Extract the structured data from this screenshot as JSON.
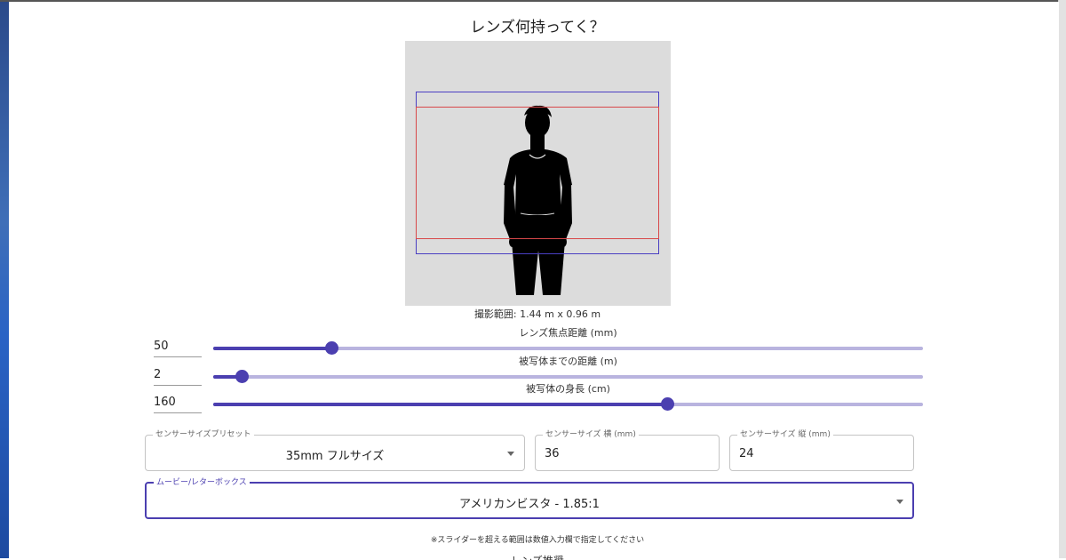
{
  "app": {
    "title": "レンズ何持ってく？"
  },
  "preview": {
    "range_text": "撮影範囲: 1.44 m x 0.96 m"
  },
  "sliders": [
    {
      "label": "レンズ焦点距離 (mm)",
      "value": "50",
      "fraction": 0.167
    },
    {
      "label": "被写体までの距離 (m)",
      "value": "2",
      "fraction": 0.04
    },
    {
      "label": "被写体の身長 (cm)",
      "value": "160",
      "fraction": 0.64
    }
  ],
  "sensor_preset": {
    "legend": "センサーサイズプリセット",
    "value": "35mm フルサイズ"
  },
  "sensor_width": {
    "legend": "センサーサイズ 横 (mm)",
    "value": "36"
  },
  "sensor_height": {
    "legend": "センサーサイズ 縦 (mm)",
    "value": "24"
  },
  "aspect": {
    "legend": "ムービー/レターボックス",
    "value": "アメリカンビスタ - 1.85:1"
  },
  "note": "※スライダーを超える範囲は数値入力欄で指定してください",
  "cut_text": "レンズ推奨",
  "colors": {
    "accent": "#4b3fb0",
    "track": "#b9b4df",
    "preview_bg": "#dcdcdc",
    "frame_blue": "#4a3fc2",
    "frame_red": "#d8484a"
  },
  "icons": {
    "preset_dropdown": "triangle-down",
    "aspect_dropdown": "triangle-down"
  }
}
